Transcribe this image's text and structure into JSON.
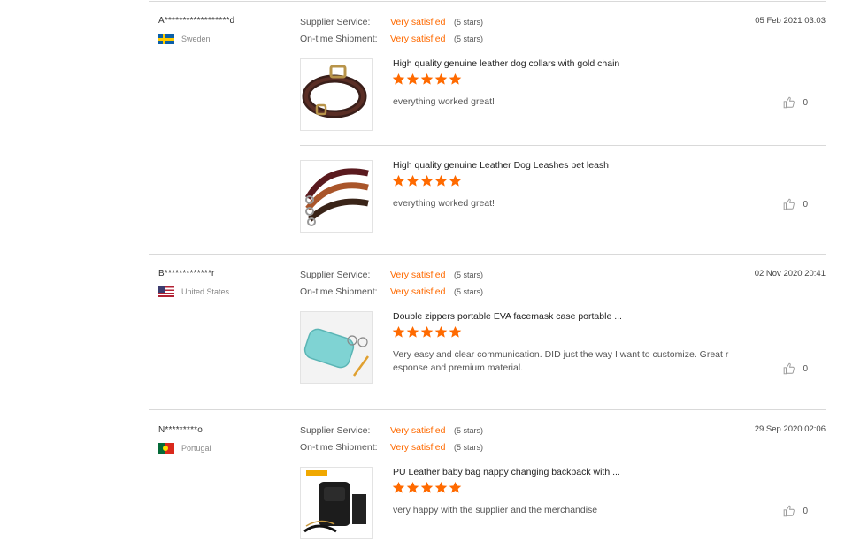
{
  "reviews": [
    {
      "buyer": "A******************d",
      "country": "Sweden",
      "supplier_service_label": "Supplier Service:",
      "supplier_service_value": "Very satisfied",
      "supplier_service_stars": "(5 stars)",
      "shipment_label": "On-time Shipment:",
      "shipment_value": "Very satisfied",
      "shipment_stars": "(5 stars)",
      "date": "05 Feb 2021 03:03",
      "products": [
        {
          "title": "High quality genuine leather dog collars with gold chain",
          "rating": 5,
          "text": "everything worked great!",
          "helpful": "0",
          "icon": "dog-collar-image"
        },
        {
          "title": "High quality genuine Leather Dog Leashes pet leash",
          "rating": 5,
          "text": "everything worked great!",
          "helpful": "0",
          "icon": "dog-leash-image"
        }
      ]
    },
    {
      "buyer": "B*************r",
      "country": "United States",
      "supplier_service_label": "Supplier Service:",
      "supplier_service_value": "Very satisfied",
      "supplier_service_stars": "(5 stars)",
      "shipment_label": "On-time Shipment:",
      "shipment_value": "Very satisfied",
      "shipment_stars": "(5 stars)",
      "date": "02 Nov 2020 20:41",
      "products": [
        {
          "title": "Double zippers portable EVA facemask case portable ...",
          "rating": 5,
          "text_line1": "Very easy and clear communication. DID just the way I want to customize. Great r",
          "text_line2": "esponse and premium material.",
          "helpful": "0",
          "icon": "mask-case-image"
        }
      ]
    },
    {
      "buyer": "N*********o",
      "country": "Portugal",
      "supplier_service_label": "Supplier Service:",
      "supplier_service_value": "Very satisfied",
      "supplier_service_stars": "(5 stars)",
      "shipment_label": "On-time Shipment:",
      "shipment_value": "Very satisfied",
      "shipment_stars": "(5 stars)",
      "date": "29 Sep 2020 02:06",
      "products": [
        {
          "title": "PU Leather baby bag nappy changing backpack with ...",
          "rating": 5,
          "text": "very happy with the supplier and the merchandise",
          "helpful": "0",
          "icon": "baby-bag-image"
        }
      ]
    }
  ],
  "colors": {
    "accent": "#ff6a00",
    "separator": "#d9d9d9"
  }
}
